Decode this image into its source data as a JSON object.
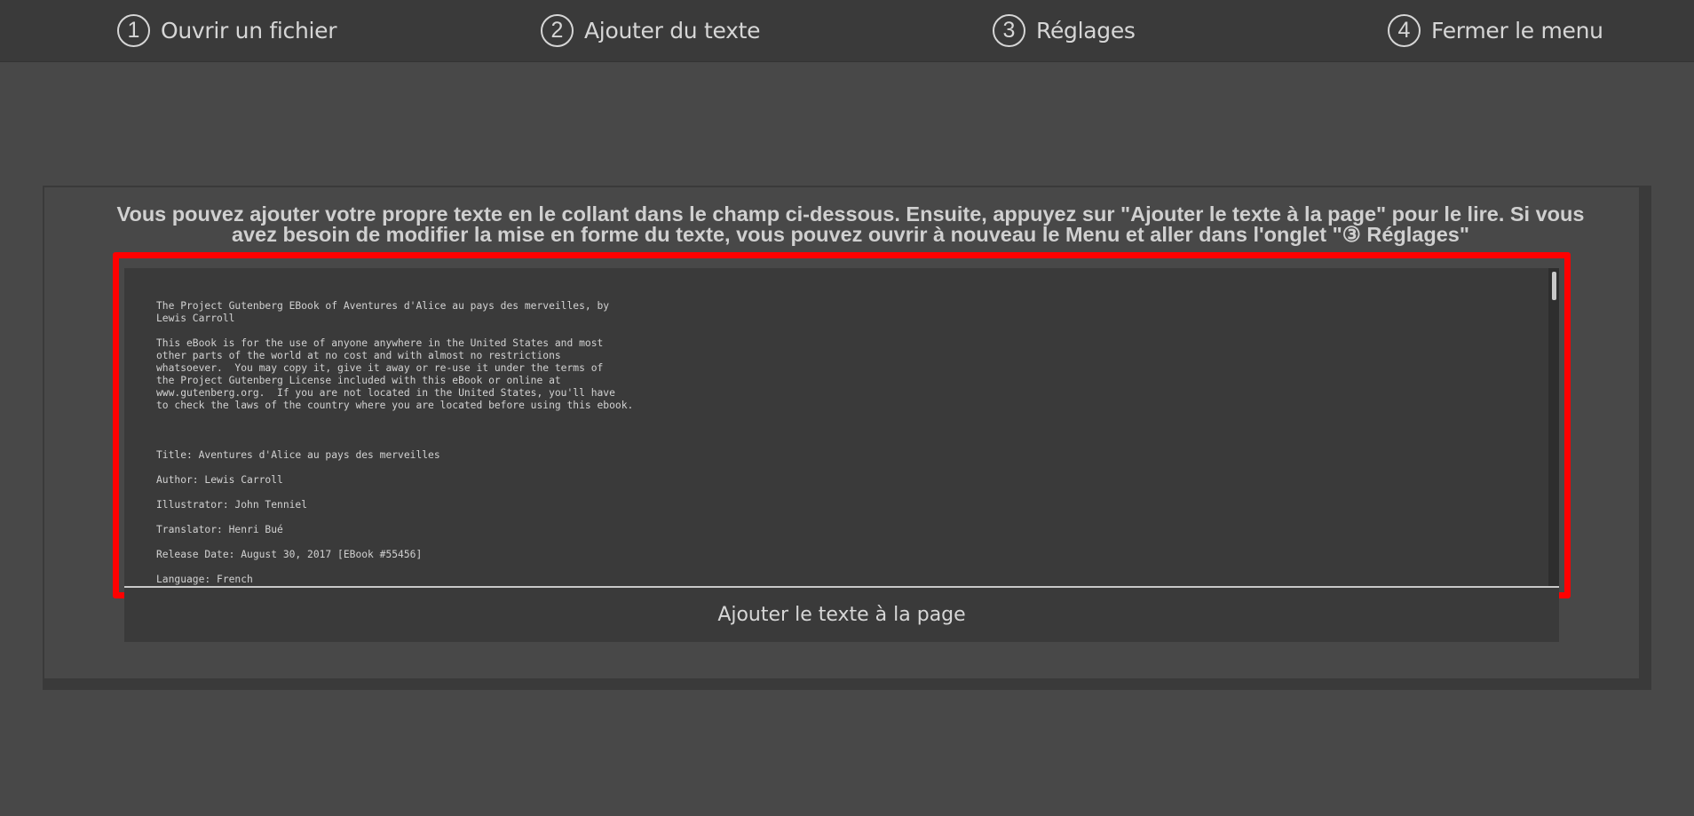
{
  "menu": {
    "items": [
      {
        "number": "1",
        "label": "Ouvrir un fichier"
      },
      {
        "number": "2",
        "label": "Ajouter du texte"
      },
      {
        "number": "3",
        "label": "Réglages"
      },
      {
        "number": "4",
        "label": "Fermer le menu"
      }
    ]
  },
  "main": {
    "instruction": "Vous pouvez ajouter votre propre texte en le collant dans le champ ci-dessous. Ensuite, appuyez sur \"Ajouter le texte à la page\" pour le lire. Si vous avez besoin de modifier la mise en forme du texte, vous pouvez ouvrir à nouveau le Menu et aller dans l'onglet \"③ Réglages\"",
    "textarea_value": "The Project Gutenberg EBook of Aventures d'Alice au pays des merveilles, by\nLewis Carroll\n\nThis eBook is for the use of anyone anywhere in the United States and most\nother parts of the world at no cost and with almost no restrictions\nwhatsoever.  You may copy it, give it away or re-use it under the terms of\nthe Project Gutenberg License included with this eBook or online at\nwww.gutenberg.org.  If you are not located in the United States, you'll have\nto check the laws of the country where you are located before using this ebook.\n\n\n\nTitle: Aventures d'Alice au pays des merveilles\n\nAuthor: Lewis Carroll\n\nIllustrator: John Tenniel\n\nTranslator: Henri Bué\n\nRelease Date: August 30, 2017 [EBook #55456]\n\nLanguage: French",
    "add_button_label": "Ajouter le texte à la page"
  },
  "colors": {
    "background": "#484848",
    "topbar": "#3a3a3a",
    "highlight": "#ff0000",
    "text": "#d6d6d6"
  }
}
